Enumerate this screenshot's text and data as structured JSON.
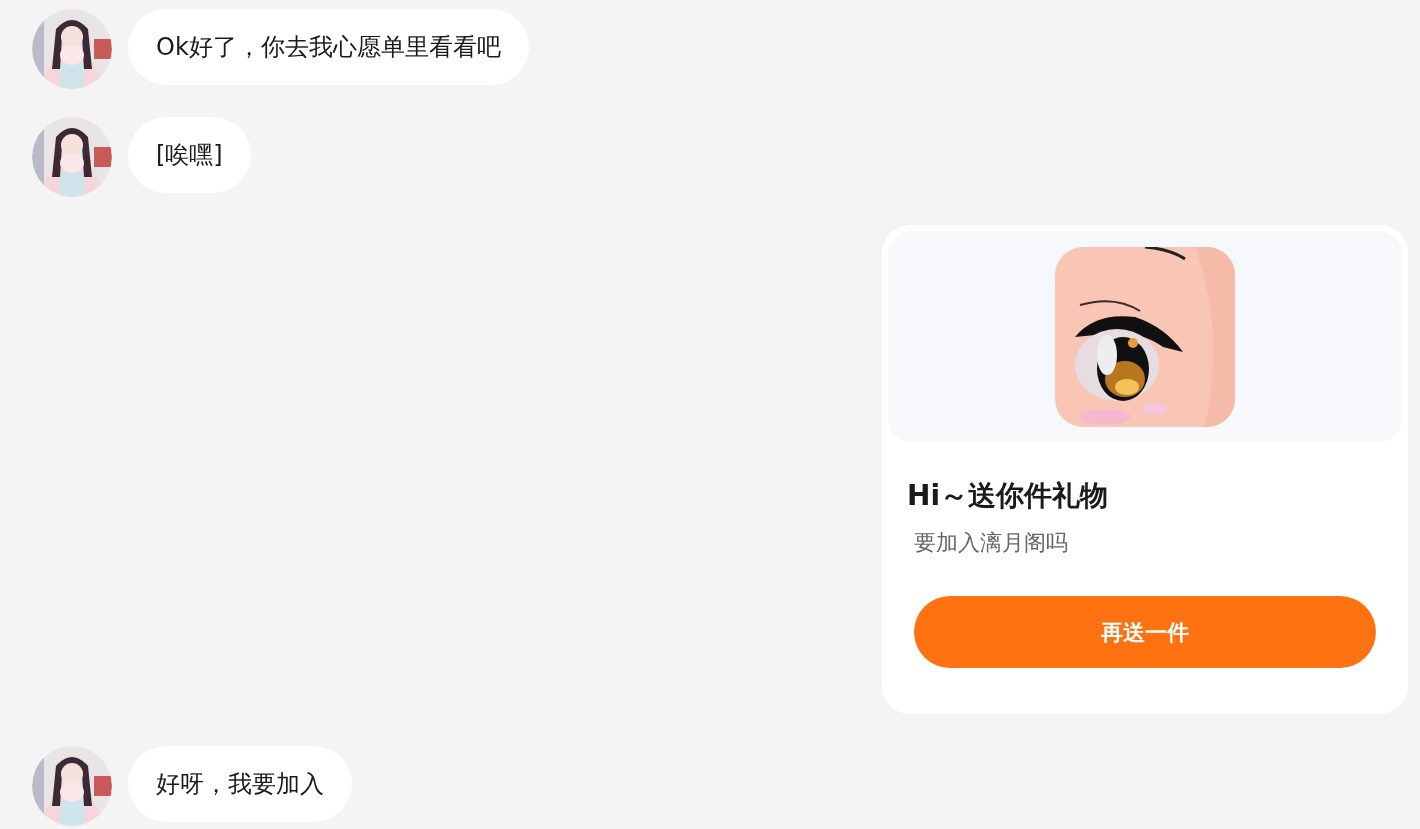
{
  "messages": [
    {
      "kind": "text",
      "outgoing": false,
      "text": "Ok好了，你去我心愿单里看看吧"
    },
    {
      "kind": "text",
      "outgoing": false,
      "text": "[唉嘿]"
    },
    {
      "kind": "gift",
      "outgoing": true,
      "title": "Hi～送你件礼物",
      "subtitle": "要加入漓月阁吗",
      "button": "再送一件"
    },
    {
      "kind": "text",
      "outgoing": false,
      "text": "好呀，我要加入"
    }
  ]
}
